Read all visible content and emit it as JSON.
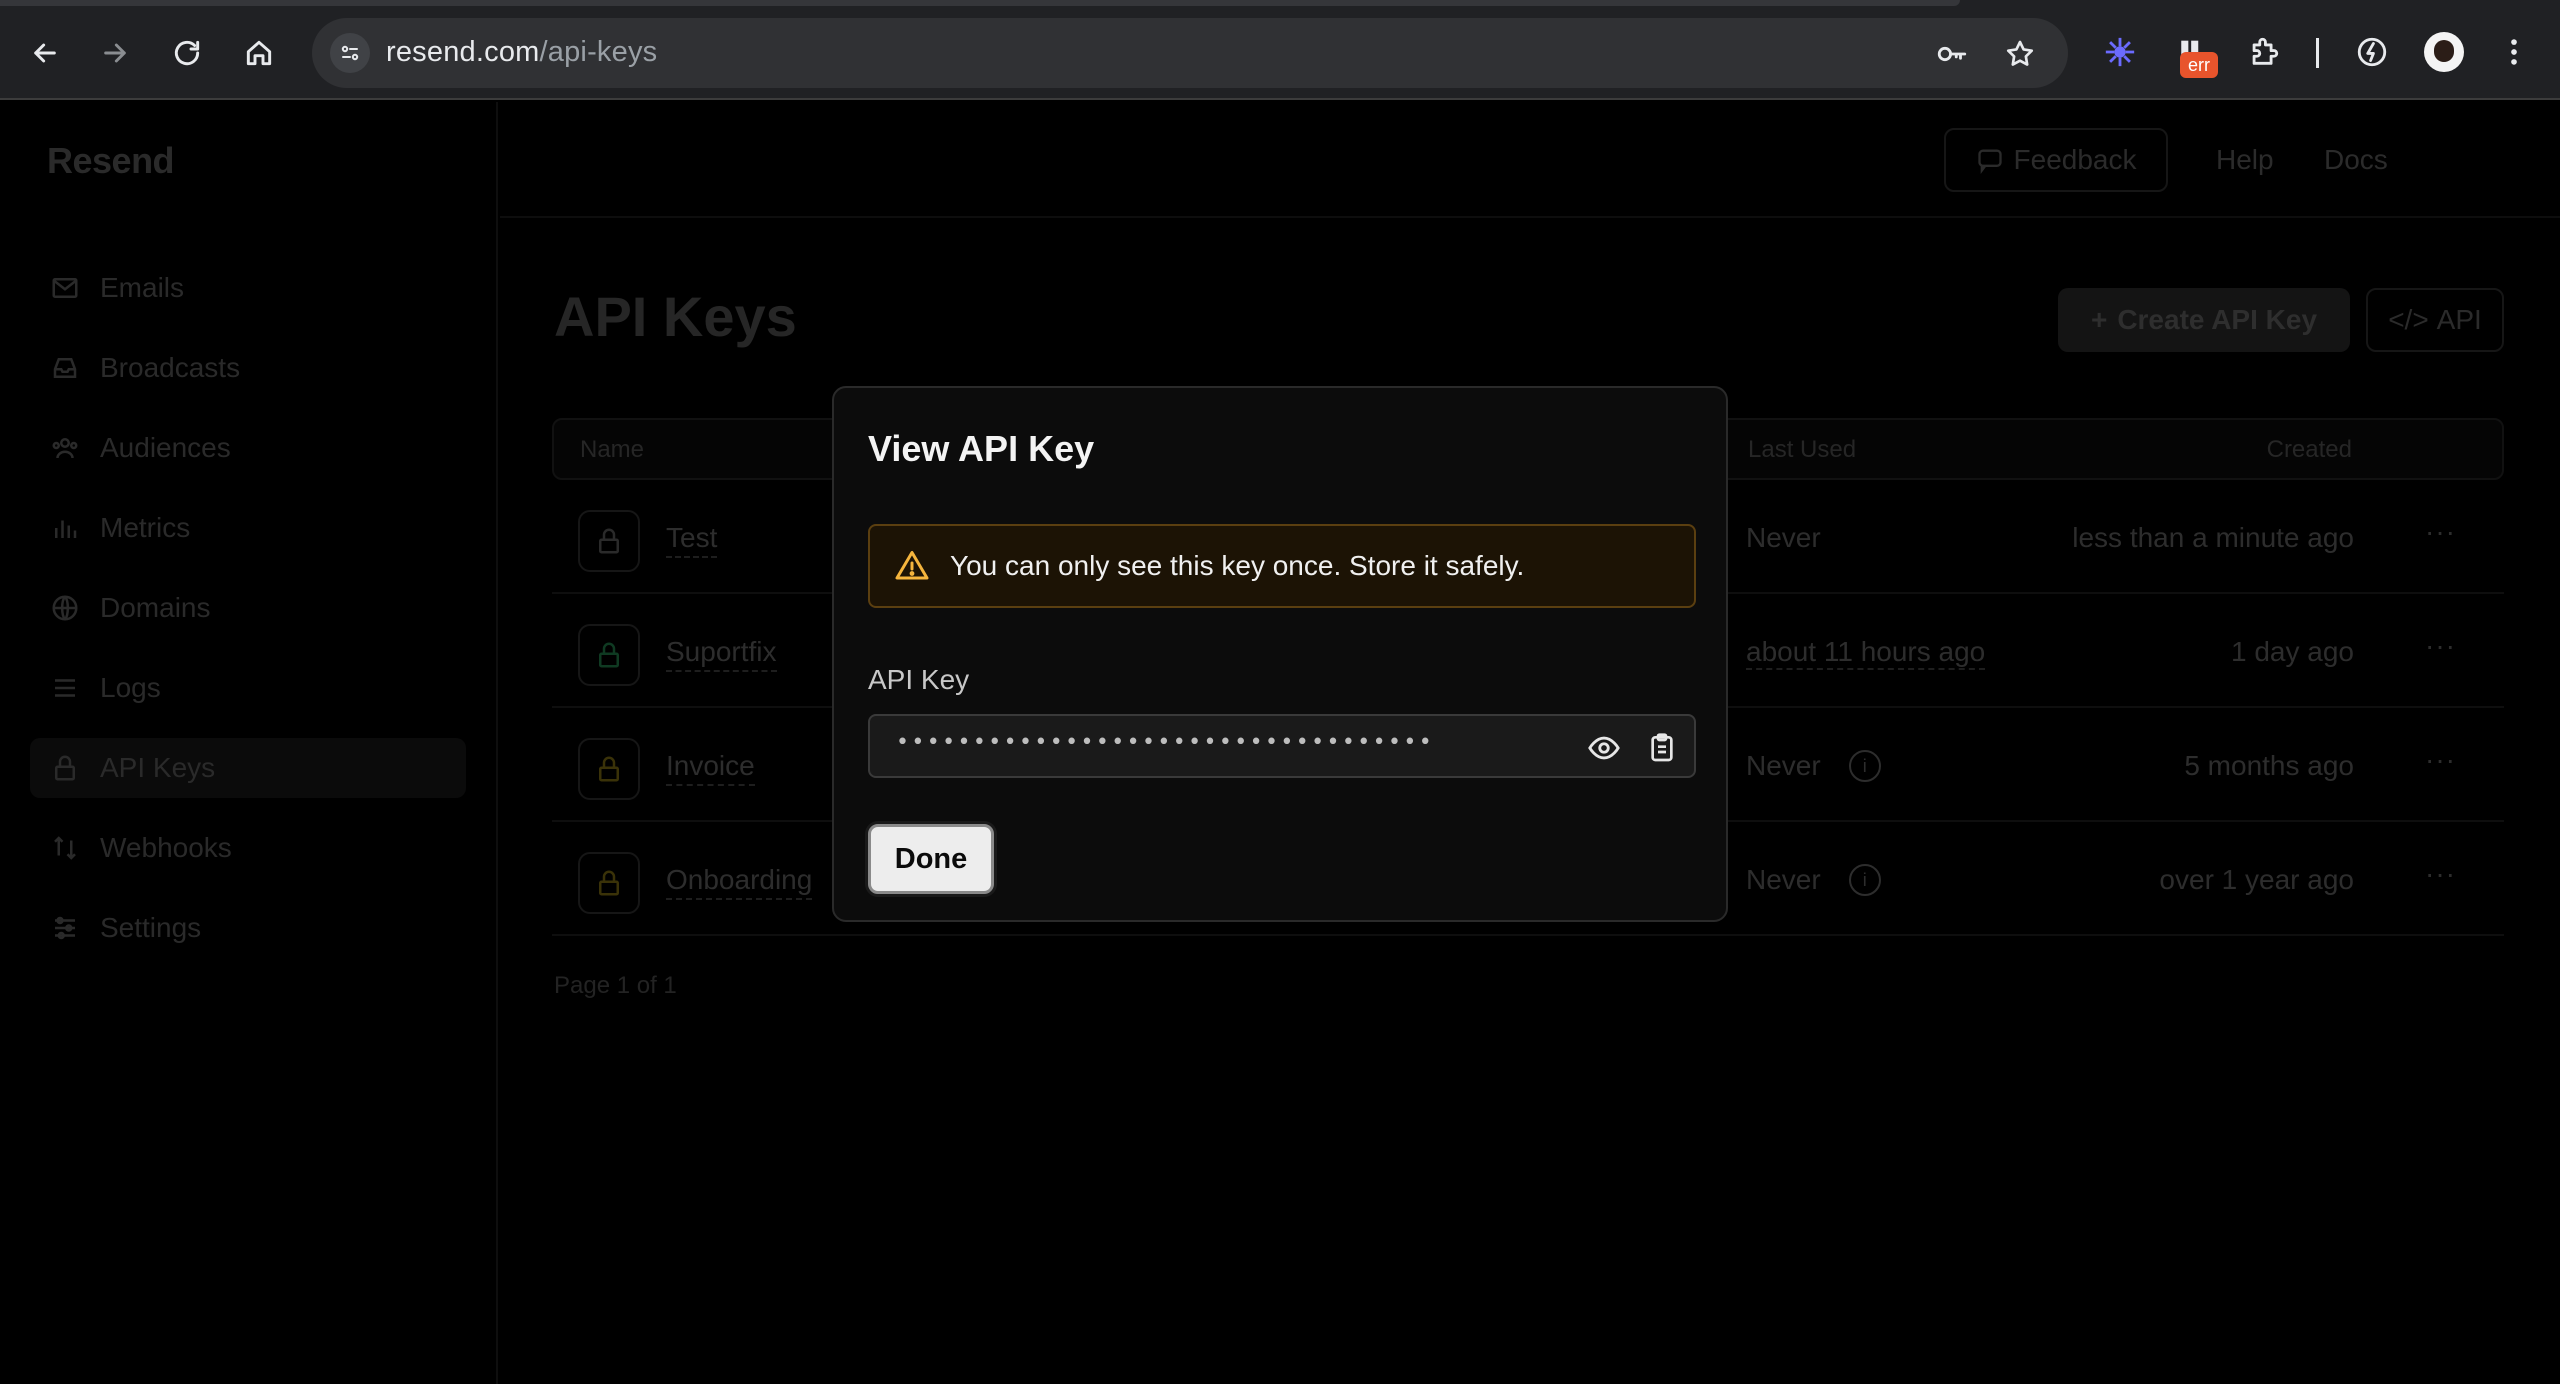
{
  "browser": {
    "url_host": "resend.com",
    "url_path": "/api-keys",
    "err_badge": "err"
  },
  "app": {
    "logo": "Resend",
    "sidebar": {
      "items": [
        {
          "label": "Emails",
          "icon": "mail-icon"
        },
        {
          "label": "Broadcasts",
          "icon": "broadcast-icon"
        },
        {
          "label": "Audiences",
          "icon": "users-icon"
        },
        {
          "label": "Metrics",
          "icon": "bar-chart-icon"
        },
        {
          "label": "Domains",
          "icon": "globe-icon"
        },
        {
          "label": "Logs",
          "icon": "list-icon"
        },
        {
          "label": "API Keys",
          "icon": "lock-icon"
        },
        {
          "label": "Webhooks",
          "icon": "webhook-icon"
        },
        {
          "label": "Settings",
          "icon": "sliders-icon"
        }
      ]
    },
    "topbar": {
      "feedback": "Feedback",
      "help": "Help",
      "docs": "Docs"
    },
    "page": {
      "title": "API Keys",
      "create_label": "Create API Key",
      "api_label": "API",
      "columns": {
        "name": "Name",
        "last_used": "Last Used",
        "created": "Created"
      },
      "rows": [
        {
          "name": "Test",
          "last_used": "Never",
          "created": "less than a minute ago",
          "key_color": "#2a2a2a"
        },
        {
          "name": "Suportfix",
          "last_used": "about 11 hours ago",
          "created": "1 day ago",
          "key_color": "#0f3a22"
        },
        {
          "name": "Invoice",
          "last_used": "Never",
          "created": "5 months ago",
          "key_color": "#3a3208"
        },
        {
          "name": "Onboarding",
          "last_used": "Never",
          "created": "over 1 year ago",
          "key_color": "#3a3208"
        }
      ],
      "pager": "Page 1 of 1"
    }
  },
  "modal": {
    "title": "View API Key",
    "warning": "You can only see this key once. Store it safely.",
    "field_label": "API Key",
    "masked_value": "•••••••••••••••••••••••••••••••••••",
    "done_label": "Done",
    "accent_warning": "#f5b53d"
  }
}
